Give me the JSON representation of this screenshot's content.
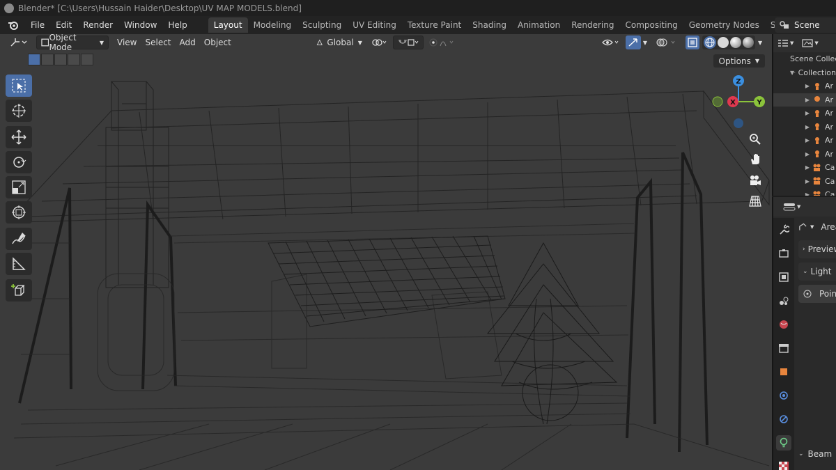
{
  "window": {
    "title": "Blender* [C:\\Users\\Hussain Haider\\Desktop\\UV MAP MODELS.blend]"
  },
  "menubar": {
    "items": [
      "File",
      "Edit",
      "Render",
      "Window",
      "Help"
    ],
    "workspaces": [
      "Layout",
      "Modeling",
      "Sculpting",
      "UV Editing",
      "Texture Paint",
      "Shading",
      "Animation",
      "Rendering",
      "Compositing",
      "Geometry Nodes",
      "Scripting"
    ],
    "active_workspace": "Layout",
    "add_label": "+",
    "scene_label": "Scene"
  },
  "viewport_header": {
    "mode": "Object Mode",
    "menus": [
      "View",
      "Select",
      "Add",
      "Object"
    ],
    "orientation": "Global",
    "options_label": "Options"
  },
  "gizmo": {
    "z_label": "Z",
    "x_label": "X",
    "y_label": "Y"
  },
  "outliner": {
    "header": "Scene Collection",
    "collection": "Collection",
    "rows": [
      "Ar",
      "Ar",
      "Ar",
      "Ar",
      "Ar",
      "Ar",
      "Ca",
      "Ca",
      "Ca"
    ]
  },
  "properties": {
    "data_label": "Area",
    "sections": [
      "Preview",
      "Light",
      "Point",
      "Beam"
    ]
  },
  "colors": {
    "accent": "#4b6fa8",
    "viewport_bg": "#3b3b3b",
    "axis_x": "#e0384f",
    "axis_y": "#8bc33b",
    "axis_z": "#3b8fe0"
  }
}
